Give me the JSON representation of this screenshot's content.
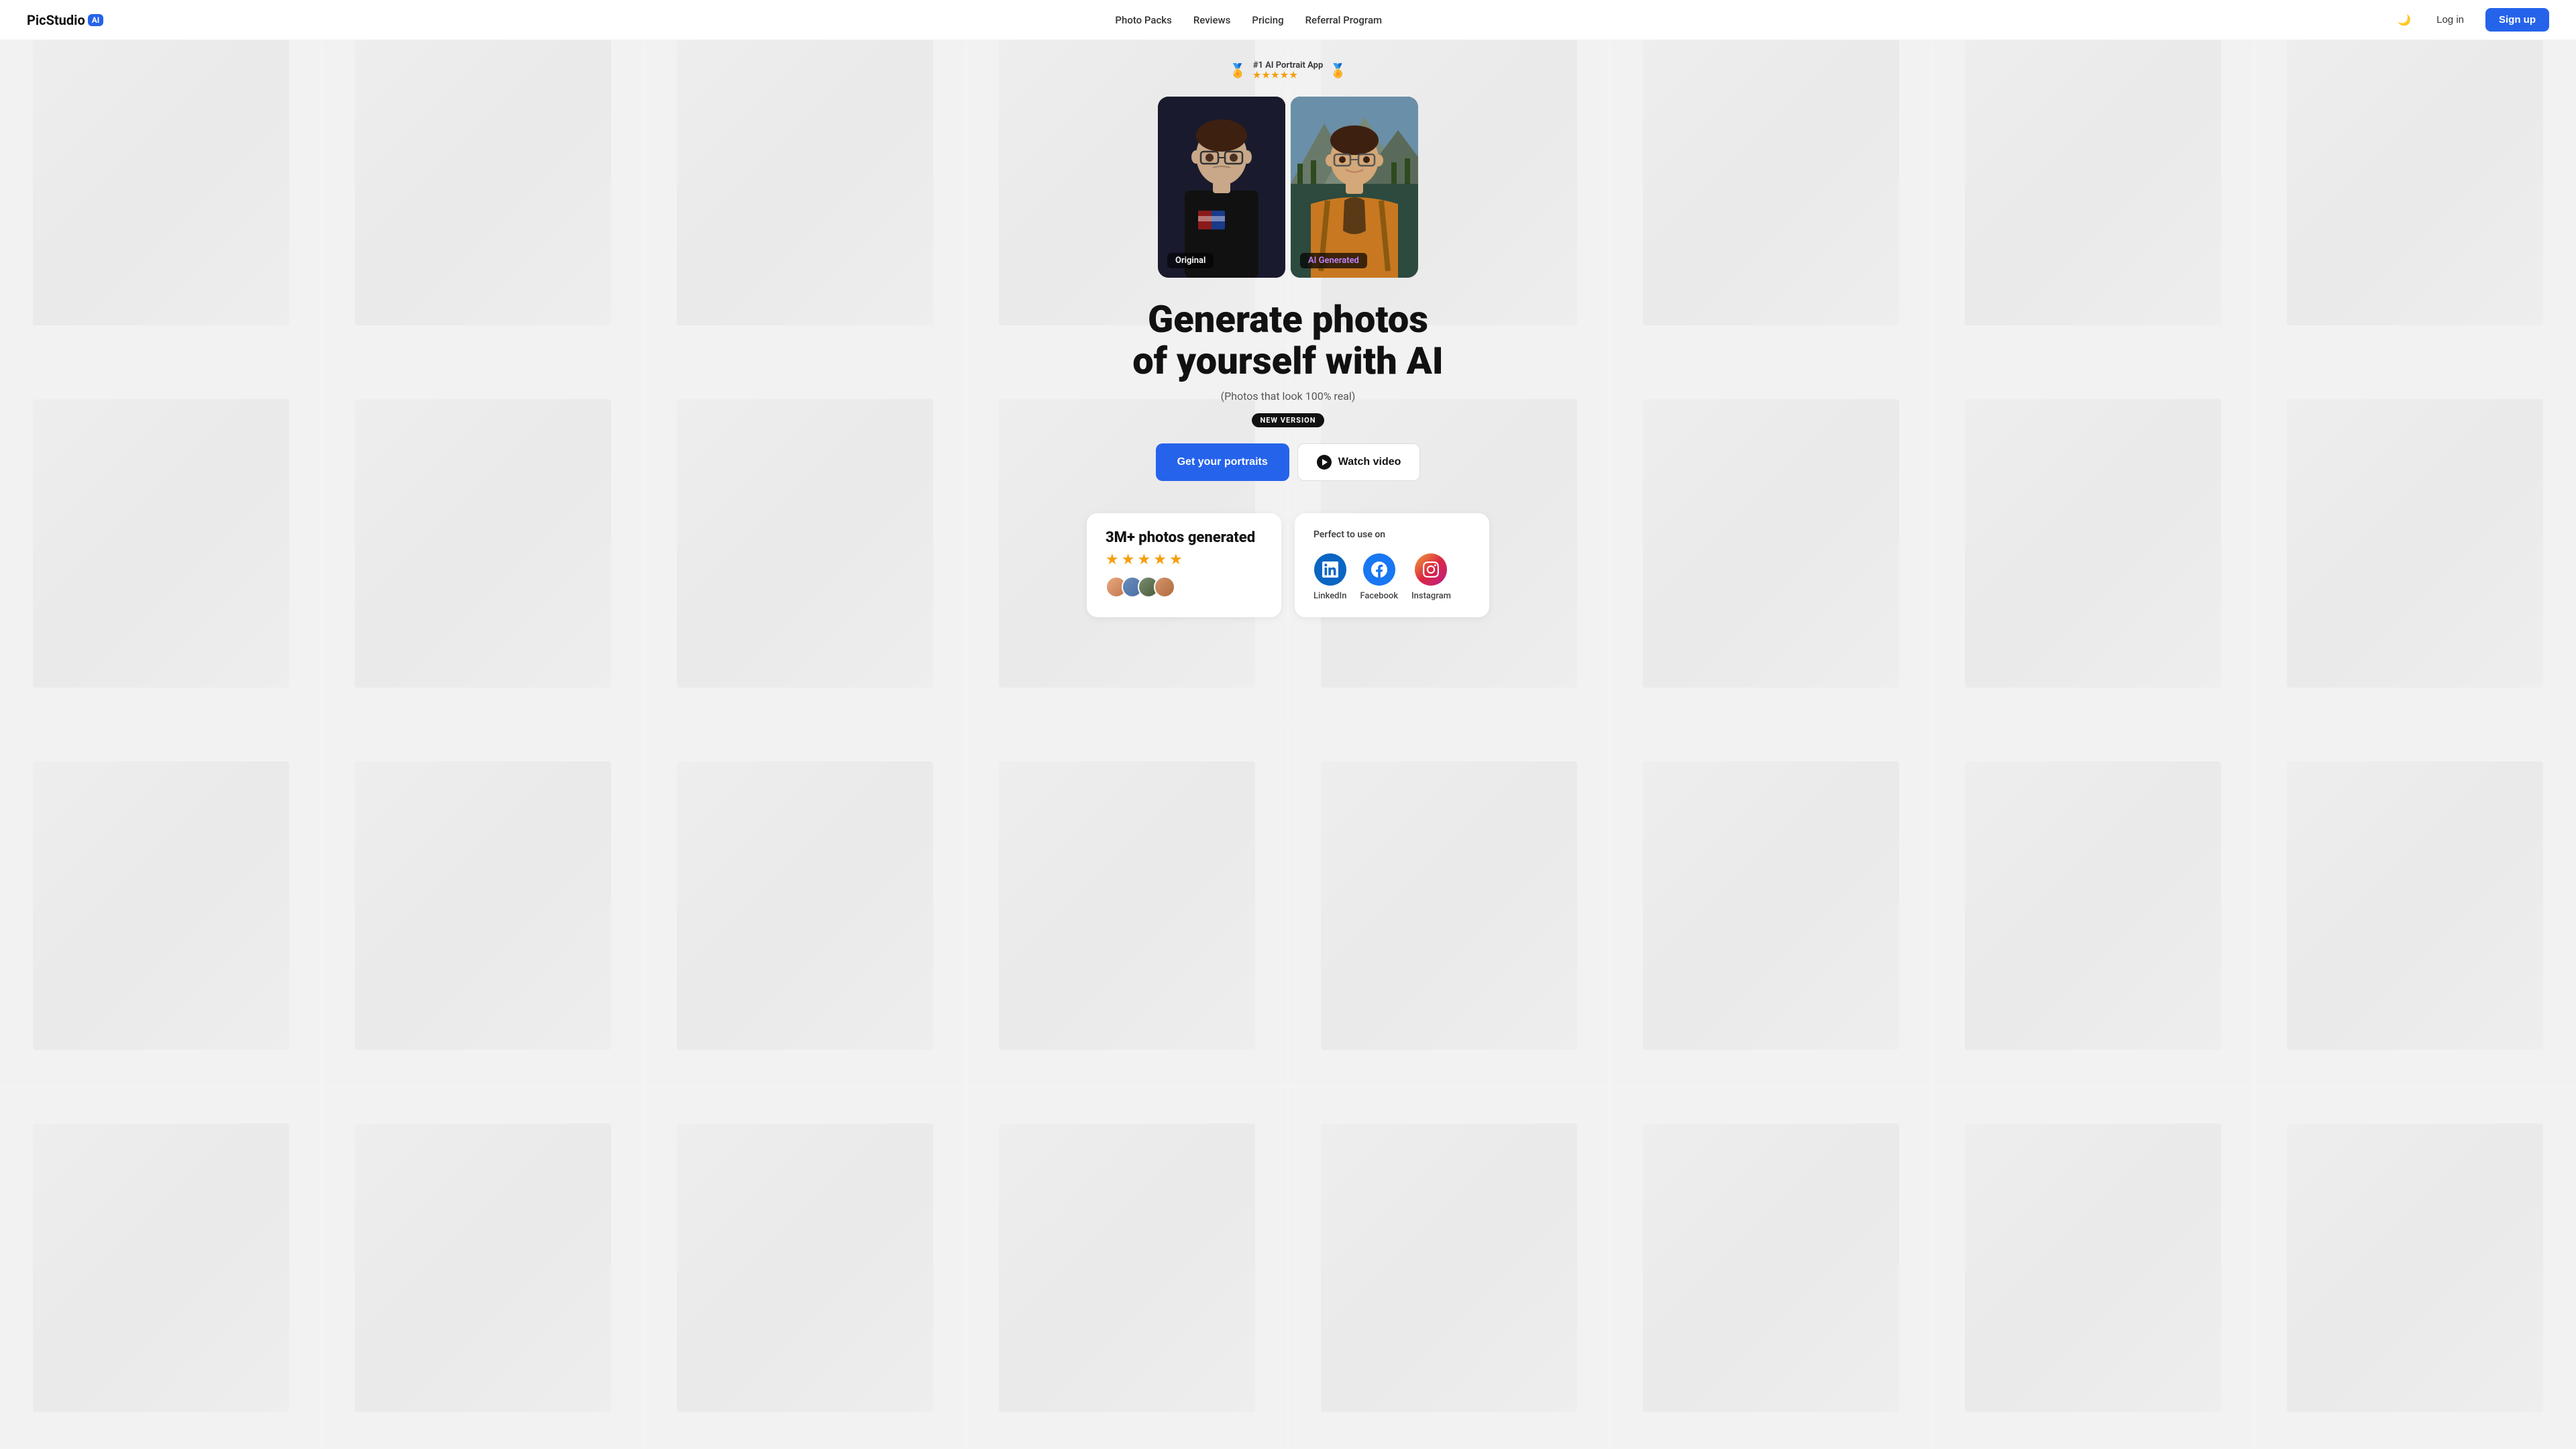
{
  "brand": {
    "name": "PicStudio",
    "ai_badge": "AI",
    "logo_text": "PicStudio"
  },
  "nav": {
    "links": [
      {
        "id": "photo-packs",
        "label": "Photo Packs"
      },
      {
        "id": "reviews",
        "label": "Reviews"
      },
      {
        "id": "pricing",
        "label": "Pricing"
      },
      {
        "id": "referral",
        "label": "Referral Program"
      }
    ],
    "login_label": "Log in",
    "signup_label": "Sign up"
  },
  "hero": {
    "award_text": "#1 AI Portrait App",
    "stars_display": "★★★★★",
    "photo_original_label": "Original",
    "photo_ai_label": "AI Generated",
    "headline_line1": "Generate photos",
    "headline_line2": "of yourself with AI",
    "subtext": "(Photos that look 100% real)",
    "new_version_badge": "NEW VERSION",
    "cta_primary": "Get your portraits",
    "cta_secondary": "Watch video"
  },
  "stats": {
    "title": "3M+ photos generated",
    "stars": [
      "★",
      "★",
      "★",
      "★",
      "★"
    ]
  },
  "social": {
    "title": "Perfect to use on",
    "platforms": [
      {
        "id": "linkedin",
        "label": "LinkedIn",
        "icon": "in"
      },
      {
        "id": "facebook",
        "label": "Facebook",
        "icon": "f"
      },
      {
        "id": "instagram",
        "label": "Instagram",
        "icon": "ig"
      }
    ]
  },
  "colors": {
    "accent": "#2563eb",
    "ai_label_color": "#c084fc"
  }
}
